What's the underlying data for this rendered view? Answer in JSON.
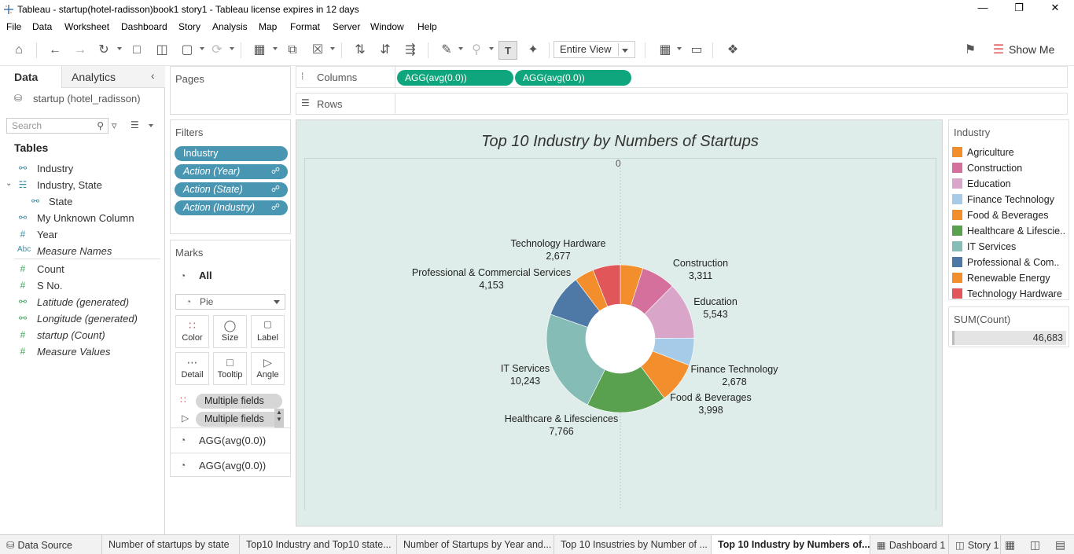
{
  "window": {
    "title": "Tableau - startup(hotel-radisson)book1 story1 - Tableau license expires in 12 days"
  },
  "menu": [
    "File",
    "Data",
    "Worksheet",
    "Dashboard",
    "Story",
    "Analysis",
    "Map",
    "Format",
    "Server",
    "Window",
    "Help"
  ],
  "toolbar": {
    "fit": "Entire View",
    "show_me": "Show Me"
  },
  "datapane": {
    "tab_data": "Data",
    "tab_analytics": "Analytics",
    "datasource": "startup (hotel_radisson)",
    "search_placeholder": "Search",
    "tables_title": "Tables",
    "fields": [
      {
        "name": "Industry",
        "icon": "globe-icon"
      },
      {
        "name": "Industry, State",
        "icon": "hierarchy-icon"
      },
      {
        "name": "State",
        "icon": "globe-icon"
      },
      {
        "name": "My Unknown Column",
        "icon": "globe-icon"
      },
      {
        "name": "Year",
        "icon": "hash-icon"
      },
      {
        "name": "Measure Names",
        "icon": "abc-icon"
      },
      {
        "name": "Count",
        "icon": "hash-icon"
      },
      {
        "name": "S No.",
        "icon": "hash-icon"
      },
      {
        "name": "Latitude (generated)",
        "icon": "globe-icon"
      },
      {
        "name": "Longitude (generated)",
        "icon": "globe-icon"
      },
      {
        "name": "startup (Count)",
        "icon": "hash-icon"
      },
      {
        "name": "Measure Values",
        "icon": "hash-icon"
      }
    ]
  },
  "shelves": {
    "pages": "Pages",
    "columns": "Columns",
    "rows": "Rows",
    "column_pills": [
      "AGG(avg(0.0))",
      "AGG(avg(0.0))"
    ]
  },
  "filters": {
    "title": "Filters",
    "items": [
      "Industry",
      "Action (Year)",
      "Action (State)",
      "Action (Industry)"
    ]
  },
  "marks": {
    "title": "Marks",
    "all": "All",
    "type": "Pie",
    "buttons": [
      "Color",
      "Size",
      "Label",
      "Detail",
      "Tooltip",
      "Angle"
    ],
    "pills": [
      "Multiple fields",
      "Multiple fields"
    ],
    "agg_rows": [
      "AGG(avg(0.0))",
      "AGG(avg(0.0))"
    ]
  },
  "view": {
    "zero_label": "0"
  },
  "legend": {
    "title": "Industry",
    "items": [
      {
        "label": "Agriculture",
        "color": "#f28e2b"
      },
      {
        "label": "Construction",
        "color": "#d4709b"
      },
      {
        "label": "Education",
        "color": "#d9a6c9"
      },
      {
        "label": "Finance Technology",
        "color": "#a6cbe8"
      },
      {
        "label": "Food & Beverages",
        "color": "#f28e2b"
      },
      {
        "label": "Healthcare & Lifescie..",
        "color": "#59a14f"
      },
      {
        "label": "IT Services",
        "color": "#86bcb6"
      },
      {
        "label": "Professional & Com..",
        "color": "#4e79a7"
      },
      {
        "label": "Renewable Energy",
        "color": "#f28e2b"
      },
      {
        "label": "Technology Hardware",
        "color": "#e15759"
      }
    ]
  },
  "sumcard": {
    "title": "SUM(Count)",
    "value": "46,683"
  },
  "chart_data": {
    "type": "pie",
    "title": "Top 10 Industry by Numbers of Startups",
    "donut": true,
    "total": 46683,
    "slices": [
      {
        "name": "Agriculture",
        "value": 2200,
        "color": "#f28e2b",
        "label": ""
      },
      {
        "name": "Construction",
        "value": 3311,
        "color": "#d4709b",
        "label": "Construction\n3,311"
      },
      {
        "name": "Education",
        "value": 5543,
        "color": "#d9a6c9",
        "label": "Education\n5,543"
      },
      {
        "name": "Finance Technology",
        "value": 2678,
        "color": "#a6cbe8",
        "label": "Finance Technology\n2,678"
      },
      {
        "name": "Food & Beverages",
        "value": 3998,
        "color": "#f28e2b",
        "label": "Food & Beverages\n3,998"
      },
      {
        "name": "Healthcare & Lifesciences",
        "value": 7766,
        "color": "#59a14f",
        "label": "Healthcare & Lifesciences\n7,766"
      },
      {
        "name": "IT Services",
        "value": 10243,
        "color": "#86bcb6",
        "label": "IT Services\n10,243"
      },
      {
        "name": "Professional & Commercial Services",
        "value": 4153,
        "color": "#4e79a7",
        "label": "Professional & Commercial Services\n4,153"
      },
      {
        "name": "Renewable Energy",
        "value": 1900,
        "color": "#f28e2b",
        "label": ""
      },
      {
        "name": "Technology Hardware",
        "value": 2677,
        "color": "#e15759",
        "label": "Technology Hardware\n2,677"
      }
    ]
  },
  "sheet_tabs": [
    {
      "label": "Data Source",
      "icon": "database-icon",
      "active": false
    },
    {
      "label": "Number of startups by state",
      "icon": "",
      "active": false
    },
    {
      "label": "Top10 Industry and Top10 state...",
      "icon": "",
      "active": false
    },
    {
      "label": "Number of Startups by Year and...",
      "icon": "",
      "active": false
    },
    {
      "label": "Top 10 Insustries by Number of ...",
      "icon": "",
      "active": false
    },
    {
      "label": "Top 10 Industry by Numbers of...",
      "icon": "",
      "active": true
    },
    {
      "label": "Dashboard 1",
      "icon": "dashboard-icon",
      "active": false
    },
    {
      "label": "Story 1",
      "icon": "story-icon",
      "active": false
    }
  ]
}
